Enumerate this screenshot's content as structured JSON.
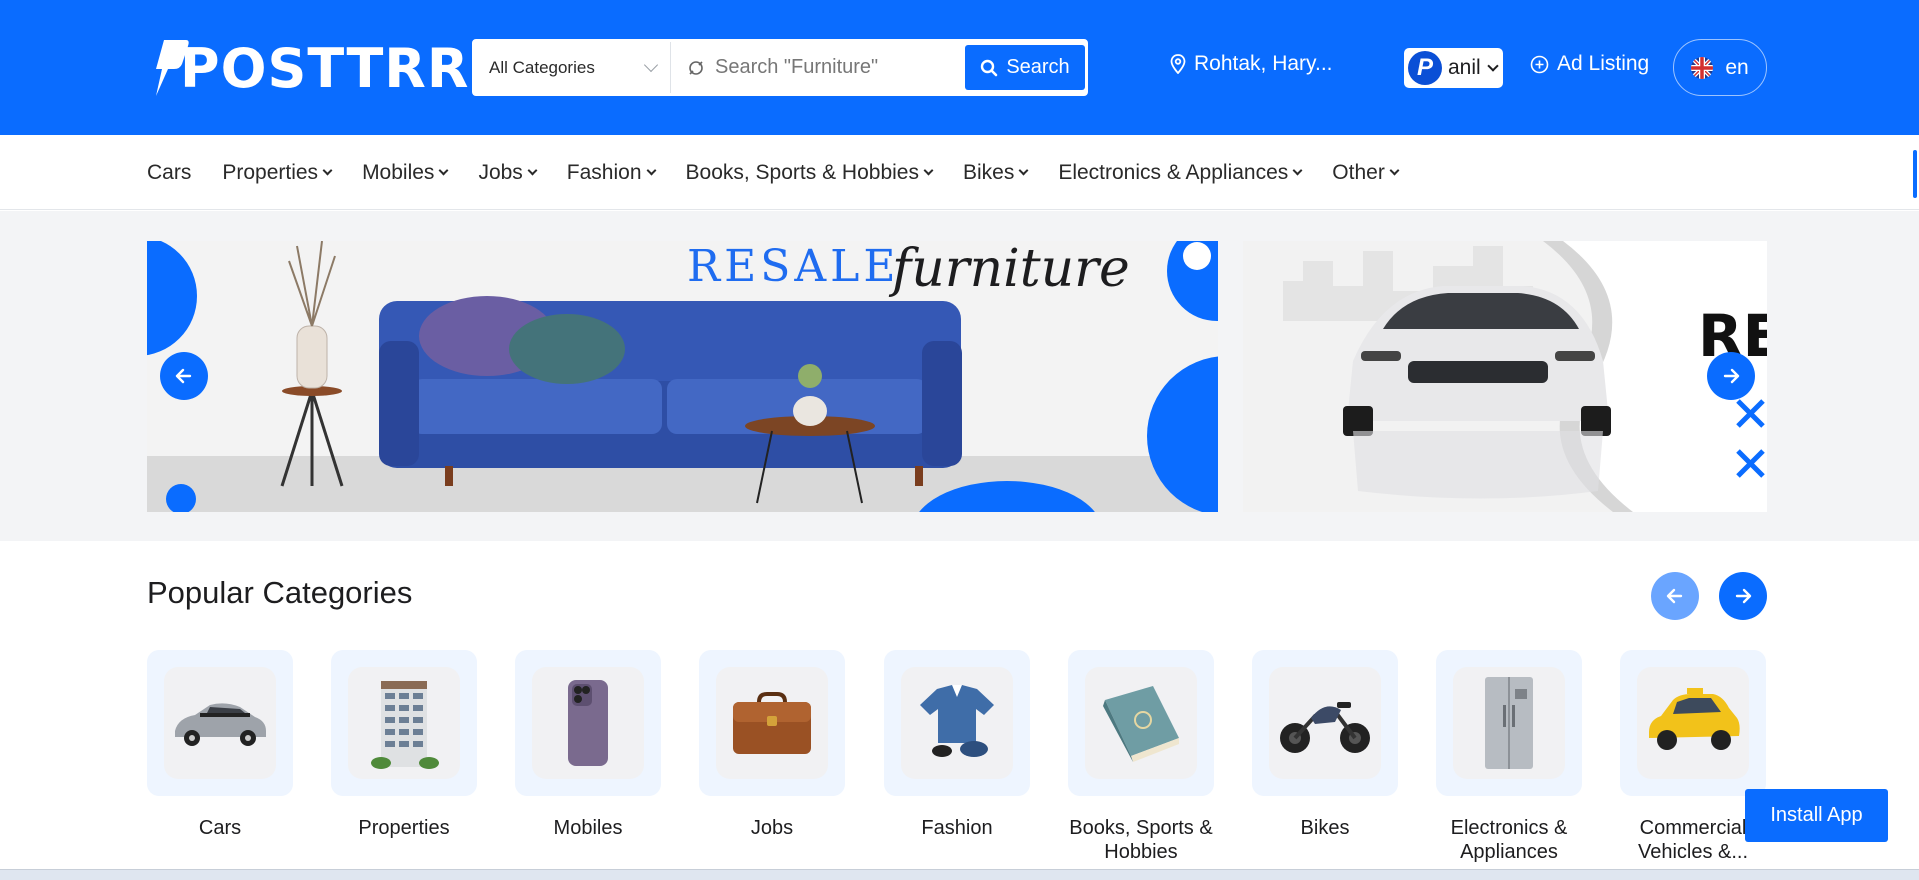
{
  "header": {
    "logo_text": "POSTTRR",
    "category_select": "All Categories",
    "search_placeholder": "Search \"Furniture\"",
    "search_button": "Search",
    "location": "Rohtak, Hary...",
    "user_name": "anil",
    "ad_listing": "Ad Listing",
    "language": "en",
    "brand_color": "#0a6cff"
  },
  "nav": {
    "items": [
      {
        "label": "Cars",
        "has_dropdown": false
      },
      {
        "label": "Properties",
        "has_dropdown": true
      },
      {
        "label": "Mobiles",
        "has_dropdown": true
      },
      {
        "label": "Jobs",
        "has_dropdown": true
      },
      {
        "label": "Fashion",
        "has_dropdown": true
      },
      {
        "label": "Books, Sports & Hobbies",
        "has_dropdown": true
      },
      {
        "label": "Bikes",
        "has_dropdown": true
      },
      {
        "label": "Electronics & Appliances",
        "has_dropdown": true
      },
      {
        "label": "Other",
        "has_dropdown": true
      }
    ]
  },
  "banner": {
    "slide1_title_a": "RESALE",
    "slide1_title_b": "furniture",
    "slide2_partial_text": "RES"
  },
  "popular": {
    "title": "Popular Categories",
    "categories": [
      {
        "label": "Cars",
        "icon": "car-icon"
      },
      {
        "label": "Properties",
        "icon": "building-icon"
      },
      {
        "label": "Mobiles",
        "icon": "phone-icon"
      },
      {
        "label": "Jobs",
        "icon": "briefcase-icon"
      },
      {
        "label": "Fashion",
        "icon": "clothes-icon"
      },
      {
        "label": "Books, Sports & Hobbies",
        "icon": "book-icon"
      },
      {
        "label": "Bikes",
        "icon": "motorbike-icon"
      },
      {
        "label": "Electronics & Appliances",
        "icon": "fridge-icon"
      },
      {
        "label": "Commercial Vehicles &...",
        "icon": "taxi-icon"
      }
    ]
  },
  "install_app": "Install App"
}
